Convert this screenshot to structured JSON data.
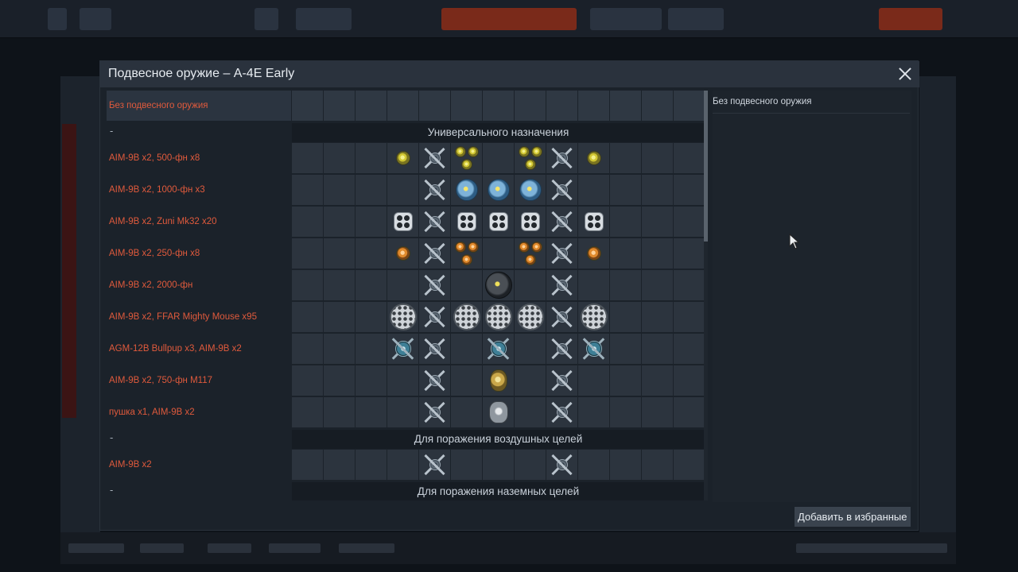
{
  "dialog": {
    "title": "Подвесное оружие – A-4E Early",
    "close_label": "×",
    "favorite_button": "Добавить в избранные"
  },
  "right_pane": {
    "selected_title": "Без подвесного оружия"
  },
  "rows": [
    {
      "type": "preset",
      "label": "Без подвесного оружия",
      "selected": true,
      "cells": [
        "",
        "",
        "",
        "",
        "",
        "",
        "",
        "",
        "",
        "",
        "",
        "",
        ""
      ]
    },
    {
      "type": "section",
      "dash": "-",
      "title": "Универсального назначения"
    },
    {
      "type": "preset",
      "label": "AIM-9B x2,  500-фн x8",
      "cells": [
        "",
        "",
        "",
        "ball-y",
        "pylon",
        "tri-y",
        "",
        "tri-y",
        "pylon",
        "ball-y",
        "",
        "",
        ""
      ]
    },
    {
      "type": "preset",
      "label": "AIM-9B x2,  1000-фн x3",
      "cells": [
        "",
        "",
        "",
        "",
        "pylon",
        "ball-b",
        "ball-b",
        "ball-b",
        "pylon",
        "",
        "",
        "",
        ""
      ]
    },
    {
      "type": "preset",
      "label": "AIM-9B x2,  Zuni Mk32 x20",
      "cells": [
        "",
        "",
        "",
        "pod4",
        "pylon",
        "pod4",
        "pod4",
        "pod4",
        "pylon",
        "pod4",
        "",
        "",
        ""
      ]
    },
    {
      "type": "preset",
      "label": "AIM-9B x2,  250-фн x8",
      "cells": [
        "",
        "",
        "",
        "ball-o",
        "pylon",
        "tri-o",
        "",
        "tri-o",
        "pylon",
        "ball-o",
        "",
        "",
        ""
      ]
    },
    {
      "type": "preset",
      "label": "AIM-9B x2,  2000-фн",
      "cells": [
        "",
        "",
        "",
        "",
        "pylon",
        "",
        "ball-k",
        "",
        "pylon",
        "",
        "",
        "",
        ""
      ]
    },
    {
      "type": "preset",
      "label": "AIM-9B x2,  FFAR Mighty Mouse x95",
      "cells": [
        "",
        "",
        "",
        "pod19",
        "pylon",
        "pod19",
        "pod19",
        "pod19",
        "pylon",
        "pod19",
        "",
        "",
        ""
      ]
    },
    {
      "type": "preset",
      "label": "AGM-12B Bullpup x3,  AIM-9B x2",
      "cells": [
        "",
        "",
        "",
        "agm",
        "pylon",
        "",
        "agm",
        "",
        "pylon",
        "agm",
        "",
        "",
        ""
      ]
    },
    {
      "type": "preset",
      "label": "AIM-9B x2,  750-фн M117",
      "cells": [
        "",
        "",
        "",
        "",
        "pylon",
        "",
        "ball-g",
        "",
        "pylon",
        "",
        "",
        "",
        ""
      ]
    },
    {
      "type": "preset",
      "label": "пушка x1,  AIM-9B x2",
      "cells": [
        "",
        "",
        "",
        "",
        "pylon",
        "",
        "ball-s",
        "",
        "pylon",
        "",
        "",
        "",
        ""
      ]
    },
    {
      "type": "section",
      "dash": "-",
      "title": "Для поражения воздушных целей"
    },
    {
      "type": "preset",
      "label": "AIM-9B x2",
      "cells": [
        "",
        "",
        "",
        "",
        "pylon",
        "",
        "",
        "",
        "pylon",
        "",
        "",
        "",
        ""
      ]
    },
    {
      "type": "section",
      "dash": "-",
      "title": "Для поражения наземных целей"
    }
  ]
}
